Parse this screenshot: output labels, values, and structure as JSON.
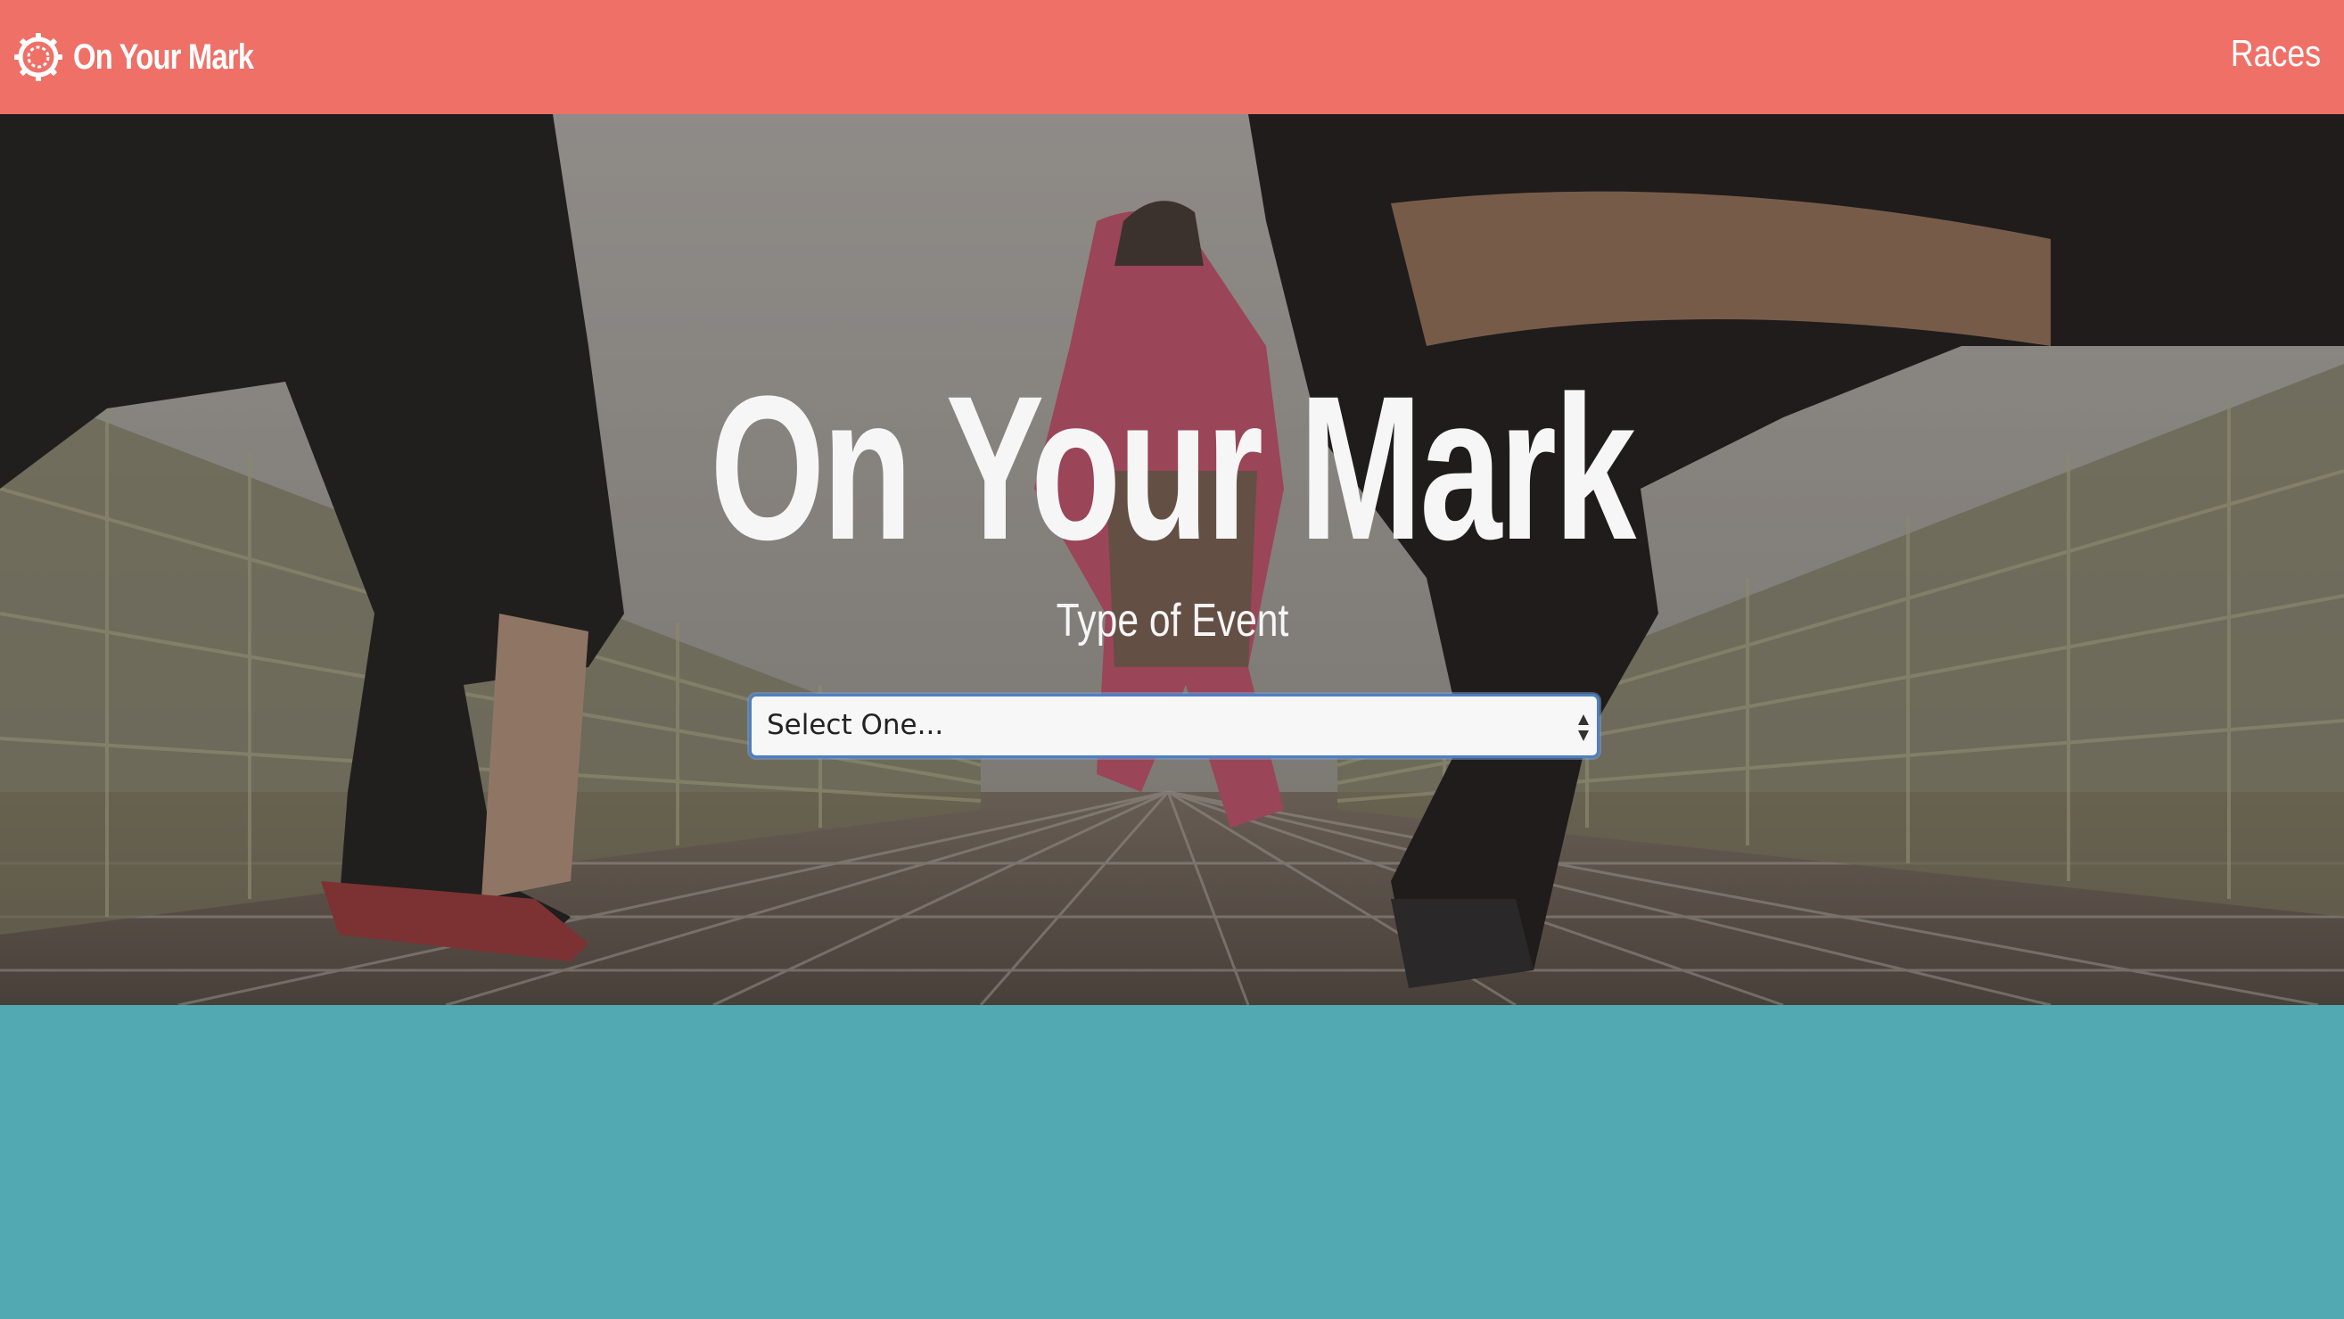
{
  "navbar": {
    "brand_text": "On Your Mark",
    "logo_icon": "gear-icon",
    "links": [
      "Races"
    ],
    "background_color": "#ef7067"
  },
  "hero": {
    "title": "On Your Mark",
    "event_label": "Type of Event",
    "select": {
      "selected": "Select One..."
    }
  },
  "colors": {
    "accent": "#ef7067",
    "teal": "#53a9b1",
    "focus_ring": "#4f7fbf"
  }
}
